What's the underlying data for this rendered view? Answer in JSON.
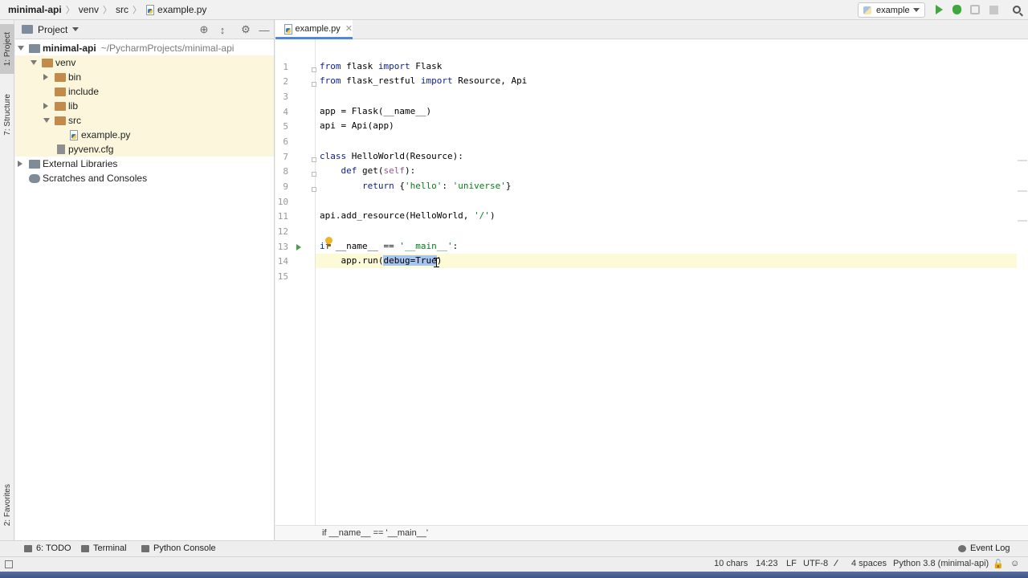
{
  "breadcrumb": {
    "project": "minimal-api",
    "folder1": "venv",
    "folder2": "src",
    "file": "example.py"
  },
  "toolbar": {
    "run_config": "example"
  },
  "sidebar_tabs": {
    "project": "1: Project",
    "structure": "7: Structure",
    "favorites": "2: Favorites"
  },
  "project_panel": {
    "title": "Project",
    "root_name": "minimal-api",
    "root_path": "~/PycharmProjects/minimal-api",
    "venv": "venv",
    "bin": "bin",
    "include": "include",
    "lib": "lib",
    "src": "src",
    "example": "example.py",
    "cfg": "pyvenv.cfg",
    "ext_libs": "External Libraries",
    "scratches": "Scratches and Consoles"
  },
  "editor": {
    "tab_label": "example.py",
    "line_numbers": [
      "1",
      "2",
      "3",
      "4",
      "5",
      "6",
      "7",
      "8",
      "9",
      "10",
      "11",
      "12",
      "13",
      "14",
      "15"
    ],
    "code": {
      "l1a": "from",
      "l1b": " flask ",
      "l1c": "import",
      "l1d": " Flask",
      "l2a": "from",
      "l2b": " flask_restful ",
      "l2c": "import",
      "l2d": " Resource, Api",
      "l4": "app = Flask(__name__)",
      "l5": "api = Api(app)",
      "l7a": "class",
      "l7b": " HelloWorld(Resource):",
      "l8a": "    ",
      "l8b": "def",
      "l8c": " get(",
      "l8d": "self",
      "l8e": "):",
      "l9a": "        ",
      "l9b": "return",
      "l9c": " {",
      "l9d": "'hello'",
      "l9e": ": ",
      "l9f": "'universe'",
      "l9g": "}",
      "l11a": "api.add_resource(HelloWorld, ",
      "l11b": "'/'",
      "l11c": ")",
      "l13a": "if",
      "l13b": " __name__ == ",
      "l13c": "'__main__'",
      "l13d": ":",
      "l14a": "    app.run(",
      "l14b": "debug=True",
      "l14c": ")"
    },
    "breadcrumb_bottom": "if __name__ == '__main__'"
  },
  "tool_windows": {
    "todo": "6: TODO",
    "terminal": "Terminal",
    "python_console": "Python Console",
    "event_log": "Event Log"
  },
  "status": {
    "selection": "10 chars",
    "position": "14:23",
    "line_sep": "LF",
    "encoding": "UTF-8",
    "indent": "4 spaces",
    "interpreter": "Python 3.8 (minimal-api)"
  }
}
